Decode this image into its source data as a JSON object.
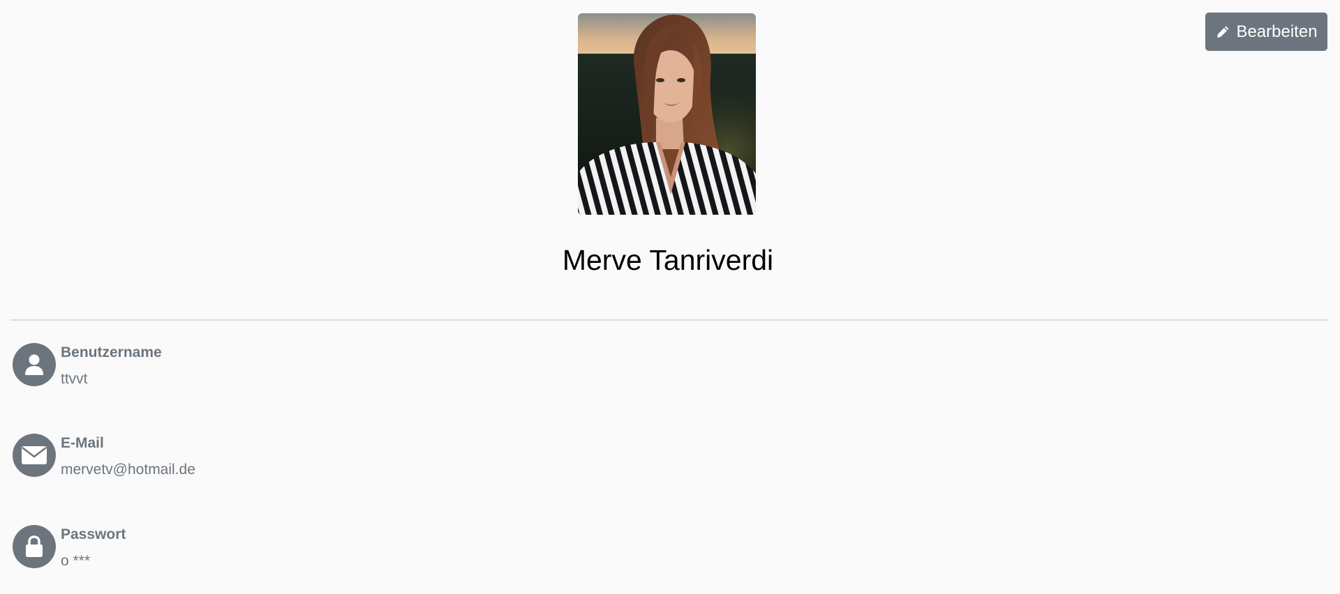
{
  "toolbar": {
    "edit_label": "Bearbeiten",
    "edit_icon": "pencil-icon"
  },
  "profile": {
    "name": "Merve Tanriverdi"
  },
  "fields": [
    {
      "label": "Benutzername",
      "value": "ttvvt",
      "icon": "user-icon"
    },
    {
      "label": "E-Mail",
      "value": "mervetv@hotmail.de",
      "icon": "envelope-icon"
    },
    {
      "label": "Passwort",
      "value": "o ***",
      "icon": "lock-icon"
    }
  ],
  "colors": {
    "accent": "#6c757d",
    "background": "#fafafa",
    "divider": "#dcdcdc",
    "name_text": "#000000"
  }
}
